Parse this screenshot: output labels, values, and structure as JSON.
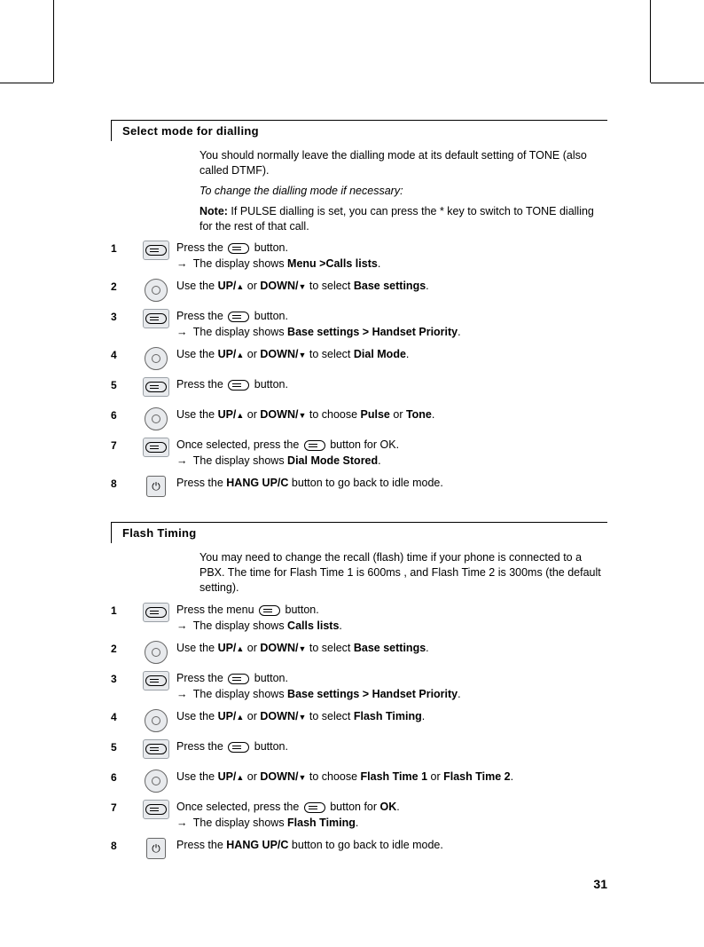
{
  "pageNumber": "31",
  "section1": {
    "title": "Select mode for dialling",
    "intro1": "You should normally leave the dialling mode at its default setting of TONE (also called DTMF).",
    "intro2": "To change the dialling mode if necessary:",
    "noteLabel": "Note:",
    "note": " If PULSE dialling is set, you can press the * key to switch to TONE dialling for the rest of that call.",
    "steps": {
      "s1a": "Press the ",
      "s1b": " button.",
      "s1c": " The display shows ",
      "s1d": "Menu >Calls lists",
      "s2a": "Use the ",
      "s2b": "UP/",
      "s2c": " or ",
      "s2d": "DOWN/",
      "s2e": " to select ",
      "s2f": "Base settings",
      "s3a": "Press the ",
      "s3b": " button.",
      "s3c": " The display shows ",
      "s3d": "Base settings > Handset Priority",
      "s4a": "Use the ",
      "s4b": "UP/",
      "s4c": " or ",
      "s4d": "DOWN/",
      "s4e": " to select ",
      "s4f": "Dial Mode",
      "s5a": "Press the ",
      "s5b": " button.",
      "s6a": "Use the ",
      "s6b": "UP/",
      "s6c": " or ",
      "s6d": "DOWN/",
      "s6e": " to choose ",
      "s6f": "Pulse",
      "s6g": " or ",
      "s6h": "Tone",
      "s7a": "Once selected, press the ",
      "s7b": " button for OK.",
      "s7c": " The display shows ",
      "s7d": "Dial Mode Stored",
      "s8a": "Press the ",
      "s8b": "HANG UP/C",
      "s8c": " button to go back to idle mode."
    },
    "nums": {
      "n1": "1",
      "n2": "2",
      "n3": "3",
      "n4": "4",
      "n5": "5",
      "n6": "6",
      "n7": "7",
      "n8": "8"
    }
  },
  "section2": {
    "title": "Flash Timing",
    "intro1": "You may need to change the recall (flash) time if your phone is connected to a PBX. The time for Flash Time 1 is 600ms , and Flash Time 2 is 300ms (the default setting).",
    "steps": {
      "s1a": "Press the menu ",
      "s1b": " button.",
      "s1c": " The display shows ",
      "s1d": "Calls lists",
      "s2a": "Use the ",
      "s2b": "UP/",
      "s2c": " or ",
      "s2d": "DOWN/",
      "s2e": " to select ",
      "s2f": "Base settings",
      "s3a": "Press the ",
      "s3b": " button.",
      "s3c": " The display shows ",
      "s3d": "Base settings > Handset Priority",
      "s4a": "Use the ",
      "s4b": "UP/",
      "s4c": " or ",
      "s4d": "DOWN/",
      "s4e": " to select ",
      "s4f": "Flash Timing",
      "s5a": "Press the ",
      "s5b": " button.",
      "s6a": "Use the ",
      "s6b": "UP/",
      "s6c": " or ",
      "s6d": "DOWN/",
      "s6e": " to choose ",
      "s6f": "Flash Time 1",
      "s6g": " or ",
      "s6h": "Flash Time 2",
      "s7a": "Once selected, press the ",
      "s7b": " button for ",
      "s7bb": "OK",
      "s7c": " The display shows ",
      "s7d": "Flash Timing",
      "s8a": "Press the ",
      "s8b": "HANG UP/C",
      "s8c": " button to go back to idle mode."
    },
    "nums": {
      "n1": "1",
      "n2": "2",
      "n3": "3",
      "n4": "4",
      "n5": "5",
      "n6": "6",
      "n7": "7",
      "n8": "8"
    }
  }
}
